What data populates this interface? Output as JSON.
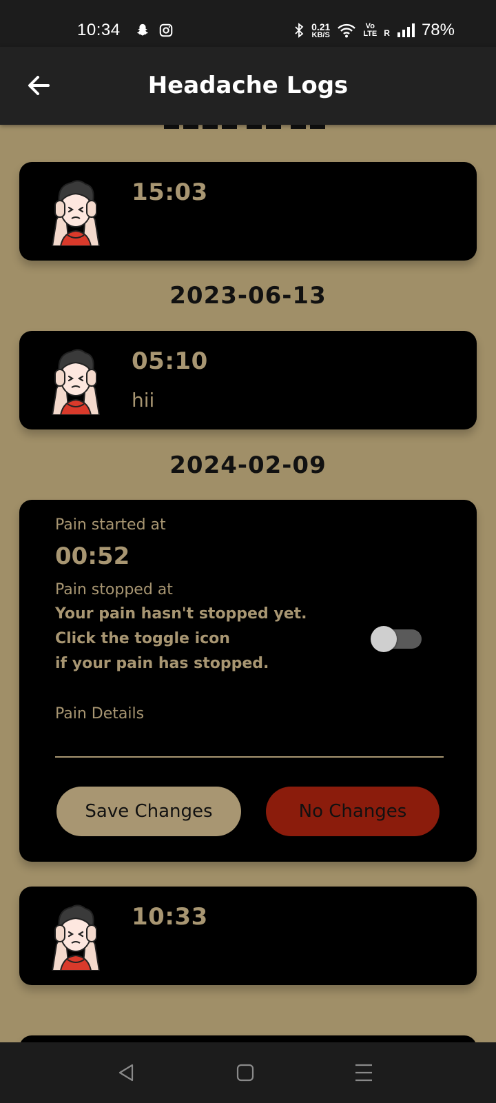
{
  "status_bar": {
    "time": "10:34",
    "speed_value": "0.21",
    "speed_unit": "KB/S",
    "volte_top": "Vo",
    "volte_bottom": "LTE",
    "roaming": "R",
    "battery": "78%"
  },
  "header": {
    "title": "Headache Logs"
  },
  "entries": [
    {
      "time": "15:03",
      "note": ""
    },
    {
      "date": "2023-06-13",
      "time": "05:10",
      "note": "hii"
    },
    {
      "date": "2024-02-09"
    },
    {
      "time": "10:33",
      "note": ""
    }
  ],
  "edit_card": {
    "pain_started_label": "Pain started at",
    "pain_started_time": "00:52",
    "pain_stopped_label": "Pain stopped at",
    "notice_line1": "Your pain hasn't stopped yet.",
    "notice_line2": "Click the toggle icon",
    "notice_line3": "if your pain has stopped.",
    "toggle_on": false,
    "pain_details_label": "Pain Details",
    "pain_details_value": "",
    "save_label": "Save Changes",
    "no_changes_label": "No Changes"
  },
  "colors": {
    "background": "#a08f68",
    "card": "#000000",
    "accent": "#a89672",
    "danger": "#8b1c0c",
    "app_bar": "#222222"
  },
  "icons": {
    "back": "arrow-left-icon",
    "avatar": "headache-person-icon",
    "nav_back": "triangle-back-icon",
    "nav_home": "square-home-icon",
    "nav_menu": "menu-lines-icon"
  }
}
